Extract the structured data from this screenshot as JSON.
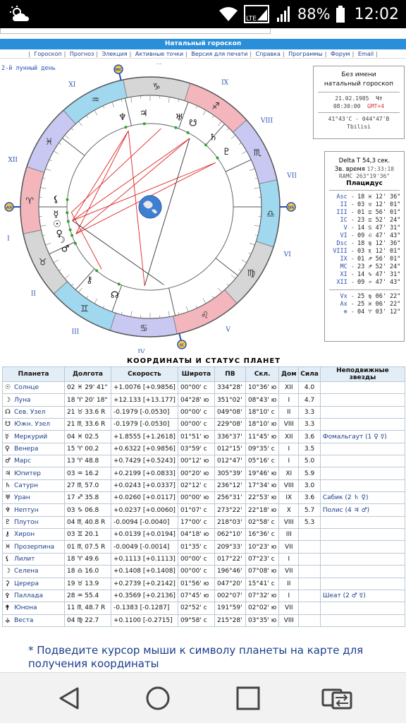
{
  "status": {
    "battery_pct": "88%",
    "clock": "12:02",
    "icons": [
      "weather-partly-cloudy-icon",
      "wifi-icon",
      "sim-signal-icon",
      "cell-signal-icon"
    ]
  },
  "page": {
    "title": "Натальный гороскоп",
    "nav": [
      "Гороскоп",
      "Прогноз",
      "Элекция",
      "Активные точки",
      "Версия для печати",
      "Справка",
      "Программы",
      "Форум",
      "Email"
    ],
    "lunar_day": "2-й лунный день"
  },
  "chart": {
    "signs_glyphs": [
      "♈",
      "♉",
      "♊",
      "♋",
      "♌",
      "♍",
      "♎",
      "♏",
      "♐",
      "♑",
      "♒",
      "♓"
    ],
    "house_numbers": [
      "I",
      "II",
      "III",
      "IV",
      "V",
      "VI",
      "VII",
      "VIII",
      "IX",
      "X",
      "XI",
      "XII"
    ],
    "axis_labels": {
      "mc": "MC",
      "ic": "IC",
      "as": "AS",
      "ds": "DS"
    },
    "planet_glyphs": [
      "☉",
      "☽",
      "☊",
      "☋",
      "☿",
      "♀",
      "♂",
      "♃",
      "♄",
      "♅",
      "♆",
      "♇",
      "⚷",
      "⚸"
    ]
  },
  "info": {
    "name_line1": "Без имени",
    "name_line2": "натальный гороскоп",
    "date": "21.02.1985",
    "weekday": "Чт",
    "time": "08:30:00",
    "gmt": "GMT+4",
    "coords": "41°43'С - 044°47'В",
    "city": "Tbilisi",
    "delta_t": "Delta T   54,3 сек.",
    "sidereal_label": "Зв. время",
    "sidereal": "17:33:18",
    "ramc": "RAMC 263°19'36\"",
    "system": "Плацидус",
    "houses": [
      {
        "label": "Asc",
        "value": "18 ♓ 12' 36\""
      },
      {
        "label": "II",
        "value": "03 ♉ 12' 01\""
      },
      {
        "label": "III",
        "value": "01 ♊ 56' 01\""
      },
      {
        "label": "IC",
        "value": "23 ♊ 52' 24\""
      },
      {
        "label": "V",
        "value": "14 ♋ 47' 31\""
      },
      {
        "label": "VI",
        "value": "09 ♌ 47' 43\""
      },
      {
        "label": "Dsc",
        "value": "18 ♍ 12' 36\""
      },
      {
        "label": "VIII",
        "value": "03 ♏ 12' 01\""
      },
      {
        "label": "IX",
        "value": "01 ♐ 56' 01\""
      },
      {
        "label": "MC",
        "value": "23 ♐ 52' 24\""
      },
      {
        "label": "XI",
        "value": "14 ♑ 47' 31\""
      },
      {
        "label": "XII",
        "value": "09 ♒ 47' 43\""
      }
    ],
    "vx": {
      "label": "Vx",
      "value": "25 ♍ 06' 22\""
    },
    "ax": {
      "label": "Ax",
      "value": "25 ♓ 06' 22\""
    },
    "otimes": {
      "label": "⊗",
      "value": "04 ♈ 03' 12\""
    }
  },
  "table": {
    "title": "КООРДИНАТЫ И СТАТУС ПЛАНЕТ",
    "headers": [
      "Планета",
      "Долгота",
      "Скорость",
      "Широта",
      "ПВ",
      "Скл.",
      "Дом",
      "Сила",
      "Неподвижные звезды"
    ],
    "rows": [
      {
        "glyph": "☉",
        "name": "Солнце",
        "lon": "02 ♓ 29' 41\"",
        "speed": "+1.0076 [+0.9856]",
        "lat": "00°00' с",
        "pv": "334°28'",
        "decl": "10°36' ю",
        "house": "XII",
        "power": "4.0",
        "stars": ""
      },
      {
        "glyph": "☽",
        "name": "Луна",
        "lon": "18 ♈ 20' 18\"",
        "speed": "+12.133 [+13.177]",
        "lat": "04°28' ю",
        "pv": "351°02'",
        "decl": "08°43' ю",
        "house": "I",
        "power": "4.7",
        "stars": ""
      },
      {
        "glyph": "☊",
        "name": "Сев. Узел",
        "lon": "21 ♉ 33.6  R",
        "speed": "-0.1979 [-0.0530]",
        "lat": "00°00' с",
        "pv": "049°08'",
        "decl": "18°10' с",
        "house": "II",
        "power": "3.3",
        "stars": ""
      },
      {
        "glyph": "☋",
        "name": "Южн. Узел",
        "lon": "21 ♏ 33.6  R",
        "speed": "-0.1979 [-0.0530]",
        "lat": "00°00' с",
        "pv": "229°08'",
        "decl": "18°10' ю",
        "house": "VIII",
        "power": "3.3",
        "stars": ""
      },
      {
        "glyph": "☿",
        "name": "Меркурий",
        "lon": "04 ♓ 02.5",
        "speed": "+1.8555 [+1.2618]",
        "lat": "01°51' ю",
        "pv": "336°37'",
        "decl": "11°45' ю",
        "house": "XII",
        "power": "3.6",
        "stars": "Фомальгаут (1 ♀ ☿)"
      },
      {
        "glyph": "♀",
        "name": "Венера",
        "lon": "15 ♈ 00.2",
        "speed": "+0.6322 [+0.9856]",
        "lat": "03°59' с",
        "pv": "012°15'",
        "decl": "09°35' с",
        "house": "I",
        "power": "3.5",
        "stars": ""
      },
      {
        "glyph": "♂",
        "name": "Марс",
        "lon": "13 ♈ 48.8",
        "speed": "+0.7429 [+0.5243]",
        "lat": "00°12' ю",
        "pv": "012°47'",
        "decl": "05°16' с",
        "house": "I",
        "power": "5.0",
        "stars": ""
      },
      {
        "glyph": "♃",
        "name": "Юпитер",
        "lon": "03 ♒ 16.2",
        "speed": "+0.2199 [+0.0833]",
        "lat": "00°20' ю",
        "pv": "305°39'",
        "decl": "19°46' ю",
        "house": "XI",
        "power": "5.9",
        "stars": ""
      },
      {
        "glyph": "♄",
        "name": "Сатурн",
        "lon": "27 ♏ 57.0",
        "speed": "+0.0243 [+0.0337]",
        "lat": "02°12' с",
        "pv": "236°12'",
        "decl": "17°34' ю",
        "house": "VIII",
        "power": "3.0",
        "stars": ""
      },
      {
        "glyph": "♅",
        "name": "Уран",
        "lon": "17 ♐ 35.8",
        "speed": "+0.0260 [+0.0117]",
        "lat": "00°00' ю",
        "pv": "256°31'",
        "decl": "22°53' ю",
        "house": "IX",
        "power": "3.6",
        "stars": "Сабик (2 ♄ ♀)"
      },
      {
        "glyph": "♆",
        "name": "Нептун",
        "lon": "03 ♑ 06.8",
        "speed": "+0.0237 [+0.0060]",
        "lat": "01°07' с",
        "pv": "273°22'",
        "decl": "22°18' ю",
        "house": "X",
        "power": "5.7",
        "stars": "Полис (4 ♃ ♂)"
      },
      {
        "glyph": "♇",
        "name": "Плутон",
        "lon": "04 ♏ 40.8  R",
        "speed": "-0.0094 [-0.0040]",
        "lat": "17°00' с",
        "pv": "218°03'",
        "decl": "02°58' с",
        "house": "VIII",
        "power": "5.3",
        "stars": ""
      },
      {
        "glyph": "⚷",
        "name": "Хирон",
        "lon": "03 ♊ 20.1",
        "speed": "+0.0139 [+0.0194]",
        "lat": "04°18' ю",
        "pv": "062°10'",
        "decl": "16°36' с",
        "house": "III",
        "power": "",
        "stars": ""
      },
      {
        "glyph": "♓",
        "name": "Прозерпина",
        "lon": "01 ♏ 07.5  R",
        "speed": "-0.0049 [-0.0014]",
        "lat": "01°35' с",
        "pv": "209°33'",
        "decl": "10°23' ю",
        "house": "VII",
        "power": "",
        "stars": ""
      },
      {
        "glyph": "⚸",
        "name": "Лилит",
        "lon": "18 ♈ 49.6",
        "speed": "+0.1113 [+0.1113]",
        "lat": "00°00' с",
        "pv": "017°22'",
        "decl": "07°23' с",
        "house": "I",
        "power": "",
        "stars": ""
      },
      {
        "glyph": "☽",
        "name": "Селена",
        "lon": "18 ♎ 16.0",
        "speed": "+0.1408 [+0.1408]",
        "lat": "00°00' с",
        "pv": "196°46'",
        "decl": "07°08' ю",
        "house": "VII",
        "power": "",
        "stars": ""
      },
      {
        "glyph": "⚳",
        "name": "Церера",
        "lon": "19 ♉ 13.9",
        "speed": "+0.2739 [+0.2142]",
        "lat": "01°56' ю",
        "pv": "047°20'",
        "decl": "15°41' с",
        "house": "II",
        "power": "",
        "stars": ""
      },
      {
        "glyph": "⚴",
        "name": "Паллада",
        "lon": "28 ♒ 55.4",
        "speed": "+0.3569 [+0.2136]",
        "lat": "07°45' ю",
        "pv": "002°07'",
        "decl": "07°32' ю",
        "house": "I",
        "power": "",
        "stars": "Шеат (2 ♂ ☿)"
      },
      {
        "glyph": "⚵",
        "name": "Юнона",
        "lon": "11 ♏ 48.7  R",
        "speed": "-0.1383 [-0.1287]",
        "lat": "02°52' с",
        "pv": "191°59'",
        "decl": "02°02' ю",
        "house": "VII",
        "power": "",
        "stars": ""
      },
      {
        "glyph": "⚶",
        "name": "Веста",
        "lon": "04 ♍ 22.7",
        "speed": "+0.1100 [-0.2715]",
        "lat": "09°58' с",
        "pv": "215°28'",
        "decl": "03°35' ю",
        "house": "VIII",
        "power": "",
        "stars": ""
      }
    ]
  },
  "note": "* Подведите курсор мыши к символу планеты на карте для получения координаты",
  "navbar_icons": [
    "back-icon",
    "home-icon",
    "recents-icon",
    "screen-switch-icon"
  ]
}
